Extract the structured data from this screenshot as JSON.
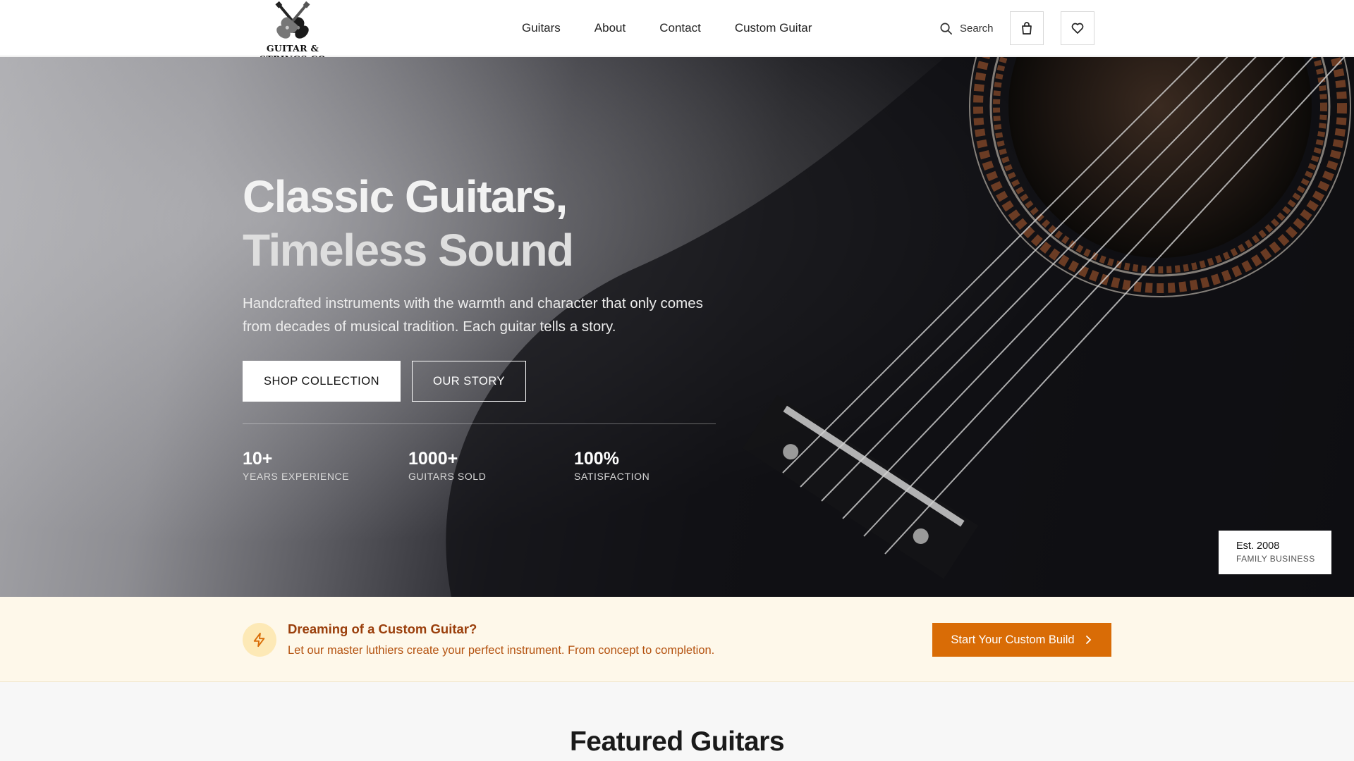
{
  "header": {
    "logo_text": "GUITAR & STRINGS CO",
    "nav": [
      {
        "label": "Guitars"
      },
      {
        "label": "About"
      },
      {
        "label": "Contact"
      },
      {
        "label": "Custom Guitar"
      }
    ],
    "search_label": "Search",
    "icons": [
      "search-icon",
      "shopping-bag-icon",
      "heart-icon"
    ]
  },
  "hero": {
    "title_line1": "Classic Guitars,",
    "title_line2": "Timeless Sound",
    "subtitle": "Handcrafted instruments with the warmth and character that only comes from decades of musical tradition. Each guitar tells a story.",
    "primary_button": "SHOP COLLECTION",
    "secondary_button": "OUR STORY",
    "stats": [
      {
        "value": "10+",
        "label": "YEARS EXPERIENCE"
      },
      {
        "value": "1000+",
        "label": "GUITARS SOLD"
      },
      {
        "value": "100%",
        "label": "SATISFACTION"
      }
    ],
    "badge": {
      "line1": "Est. 2008",
      "line2": "FAMILY BUSINESS"
    }
  },
  "custom_banner": {
    "title": "Dreaming of a Custom Guitar?",
    "subtitle": "Let our master luthiers create your perfect instrument. From concept to completion.",
    "button": "Start Your Custom Build",
    "icon": "lightning-bolt-icon"
  },
  "featured": {
    "title": "Featured Guitars"
  },
  "colors": {
    "accent": "#d96c06",
    "banner_bg": "#fef8ea",
    "banner_title": "#9a3f0c",
    "banner_text": "#b4520f"
  }
}
